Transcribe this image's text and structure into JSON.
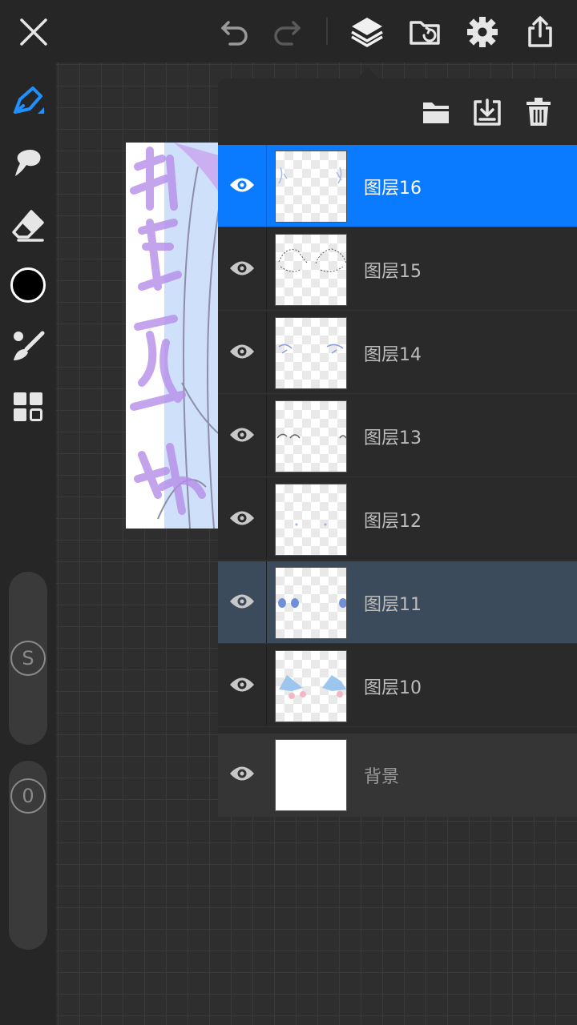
{
  "colors": {
    "accent": "#0a7bff",
    "active_layer_bg": "#0a7bff",
    "selected_layer_bg": "#3c4b5b",
    "current_color": "#000000"
  },
  "topbar": {
    "icons": [
      "close-icon",
      "undo-icon",
      "redo-icon",
      "layers-icon",
      "gallery-icon",
      "settings-icon",
      "share-icon"
    ]
  },
  "left_toolbar": {
    "tools": [
      "pen-icon",
      "smudge-icon",
      "eraser-icon",
      "color-swatch",
      "brush-settings-icon",
      "more-tools-icon"
    ],
    "size_slider": {
      "label": "S"
    },
    "opacity_slider": {
      "label": "0"
    }
  },
  "layer_panel": {
    "toolbar_icons": [
      "folder-icon",
      "merge-down-icon",
      "delete-icon"
    ],
    "layers": [
      {
        "name": "图层16",
        "state": "active",
        "visible": true
      },
      {
        "name": "图层15",
        "state": "normal",
        "visible": true
      },
      {
        "name": "图层14",
        "state": "normal",
        "visible": true
      },
      {
        "name": "图层13",
        "state": "normal",
        "visible": true
      },
      {
        "name": "图层12",
        "state": "normal",
        "visible": true
      },
      {
        "name": "图层11",
        "state": "selected",
        "visible": true
      },
      {
        "name": "图层10",
        "state": "normal",
        "visible": true
      }
    ],
    "background_layer": {
      "name": "背景",
      "visible": true
    }
  }
}
